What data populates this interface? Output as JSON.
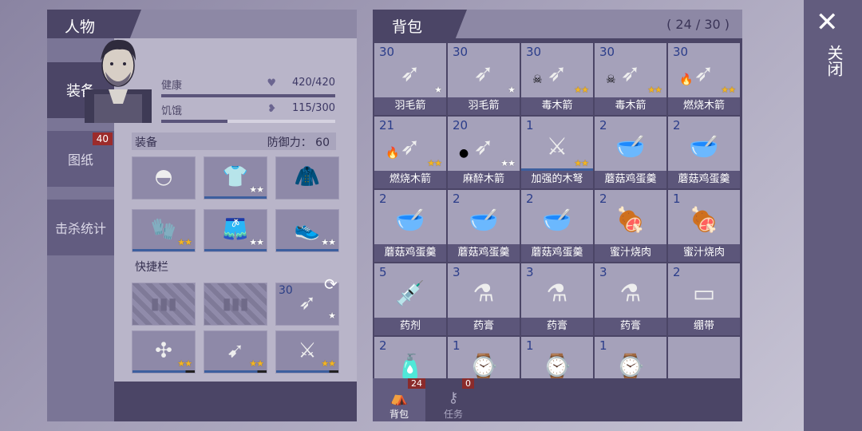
{
  "character": {
    "title": "人物",
    "tabs": [
      {
        "label": "装备",
        "active": true
      },
      {
        "label": "图纸",
        "badge": "40"
      },
      {
        "label": "击杀统计"
      }
    ],
    "stats": [
      {
        "label": "健康",
        "value": "420/420",
        "icon": "heart-icon",
        "fill": 1.0
      },
      {
        "label": "饥饿",
        "value": "115/300",
        "icon": "stomach-icon",
        "fill": 0.38
      }
    ],
    "equipment": {
      "label": "装备",
      "defense_label": "防御力：",
      "defense_value": "60",
      "slots": [
        {
          "item": "beanie-hat",
          "stars": 0
        },
        {
          "item": "shirt",
          "stars": 2,
          "star_color": "white"
        },
        {
          "item": "jacket",
          "stars": 0
        },
        {
          "item": "gloves",
          "stars": 2,
          "star_color": "gold"
        },
        {
          "item": "shorts",
          "stars": 2,
          "star_color": "white"
        },
        {
          "item": "sneakers",
          "stars": 2,
          "star_color": "white"
        }
      ]
    },
    "quickbar": {
      "label": "快捷栏",
      "slots": [
        {
          "locked": true
        },
        {
          "locked": true
        },
        {
          "item": "feather-arrow",
          "count": "30",
          "stars": 1,
          "star_color": "white"
        },
        {
          "item": "spiked-club",
          "stars": 2,
          "star_color": "gold"
        },
        {
          "item": "spear",
          "stars": 2,
          "star_color": "gold"
        },
        {
          "item": "crossbow",
          "stars": 2,
          "star_color": "gold"
        }
      ]
    }
  },
  "backpack": {
    "title": "背包",
    "count": "( 24 / 30 )",
    "items": [
      {
        "name": "羽毛箭",
        "count": "30",
        "stars": 1,
        "star_color": "white",
        "art": "arrow"
      },
      {
        "name": "羽毛箭",
        "count": "30",
        "stars": 1,
        "star_color": "white",
        "art": "arrow"
      },
      {
        "name": "毒木箭",
        "count": "30",
        "stars": 2,
        "star_color": "gold",
        "art": "arrow",
        "elem": "☠"
      },
      {
        "name": "毒木箭",
        "count": "30",
        "stars": 2,
        "star_color": "gold",
        "art": "arrow",
        "elem": "☠"
      },
      {
        "name": "燃烧木箭",
        "count": "30",
        "stars": 2,
        "star_color": "gold",
        "art": "arrow",
        "elem": "🔥"
      },
      {
        "name": "燃烧木箭",
        "count": "21",
        "stars": 2,
        "star_color": "gold",
        "art": "arrow",
        "elem": "🔥"
      },
      {
        "name": "麻醉木箭",
        "count": "20",
        "stars": 2,
        "star_color": "white",
        "art": "arrow",
        "elem": "●"
      },
      {
        "name": "加强的木弩",
        "count": "1",
        "stars": 2,
        "star_color": "gold",
        "art": "crossbow",
        "selected": true
      },
      {
        "name": "蘑菇鸡蛋羹",
        "count": "2",
        "art": "bowl"
      },
      {
        "name": "蘑菇鸡蛋羹",
        "count": "2",
        "art": "bowl"
      },
      {
        "name": "蘑菇鸡蛋羹",
        "count": "2",
        "art": "bowl"
      },
      {
        "name": "蘑菇鸡蛋羹",
        "count": "2",
        "art": "bowl"
      },
      {
        "name": "蘑菇鸡蛋羹",
        "count": "2",
        "art": "bowl"
      },
      {
        "name": "蜜汁烧肉",
        "count": "2",
        "art": "meat"
      },
      {
        "name": "蜜汁烧肉",
        "count": "1",
        "art": "meat"
      },
      {
        "name": "药剂",
        "count": "5",
        "art": "syringe"
      },
      {
        "name": "药膏",
        "count": "3",
        "art": "mortar"
      },
      {
        "name": "药膏",
        "count": "3",
        "art": "mortar"
      },
      {
        "name": "药膏",
        "count": "3",
        "art": "mortar"
      },
      {
        "name": "绷带",
        "count": "2",
        "art": "bandage"
      },
      {
        "name": "",
        "count": "2",
        "art": "bottle"
      },
      {
        "name": "",
        "count": "1",
        "art": "watch"
      },
      {
        "name": "",
        "count": "1",
        "art": "watch"
      },
      {
        "name": "",
        "count": "1",
        "art": "watch"
      }
    ],
    "tabs": [
      {
        "label": "背包",
        "badge": "24",
        "icon": "backpack-icon",
        "active": true
      },
      {
        "label": "任务",
        "badge": "0",
        "icon": "key-icon"
      }
    ]
  },
  "close": {
    "label": "关闭"
  }
}
